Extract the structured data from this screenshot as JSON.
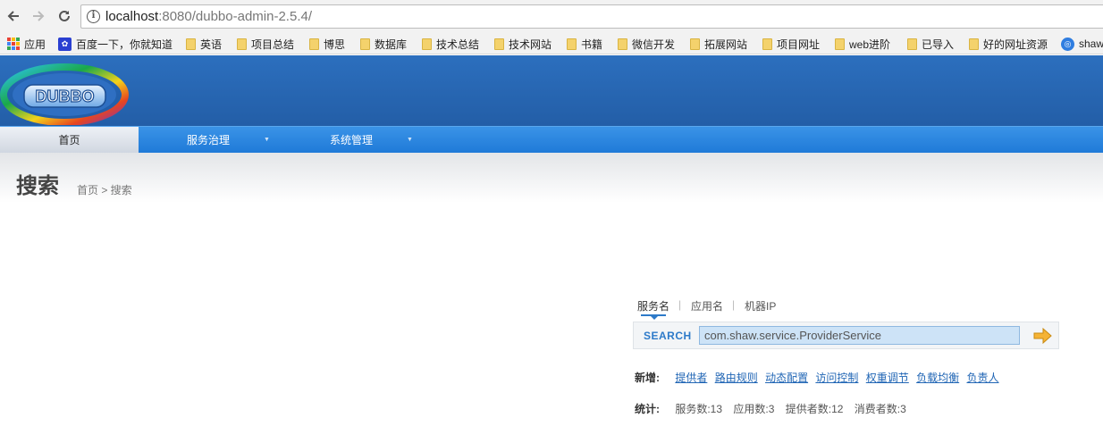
{
  "browser": {
    "url_host": "localhost",
    "url_rest": ":8080/dubbo-admin-2.5.4/",
    "bookmarks": {
      "apps": "应用",
      "baidu": "百度一下，你就知道",
      "english": "英语",
      "project_summary": "项目总结",
      "bosi": "博思",
      "database": "数据库",
      "tech_summary": "技术总结",
      "tech_sites": "技术网站",
      "books": "书籍",
      "wechat_dev": "微信开发",
      "expand_sites": "拓展网站",
      "project_urls": "项目网址",
      "web_advanced": "web进阶",
      "imported": "已导入",
      "good_resources": "好的网址资源",
      "shaw": "shaw"
    }
  },
  "logo": {
    "text": "DUBBO"
  },
  "menu": {
    "home": "首页",
    "service_governance": "服务治理",
    "system_management": "系统管理"
  },
  "page": {
    "title": "搜索",
    "breadcrumb": "首页 > 搜索"
  },
  "search": {
    "tabs": {
      "service_name": "服务名",
      "app_name": "应用名",
      "machine_ip": "机器IP"
    },
    "separator": "|",
    "label": "SEARCH",
    "value": "com.shaw.service.ProviderService"
  },
  "add": {
    "label": "新增:",
    "links": {
      "provider": "提供者",
      "route_rule": "路由规则",
      "dynamic_config": "动态配置",
      "access_control": "访问控制",
      "weight": "权重调节",
      "load_balance": "负载均衡",
      "owner": "负责人"
    }
  },
  "stats": {
    "label": "统计:",
    "services": "服务数:13",
    "apps": "应用数:3",
    "providers": "提供者数:12",
    "consumers": "消费者数:3"
  },
  "colors": {
    "header_blue": "#235ea7",
    "menu_blue": "#1f7ad8",
    "link_blue": "#2166b5",
    "search_label": "#2d7ac9",
    "arrow_orange": "#f5b335"
  }
}
